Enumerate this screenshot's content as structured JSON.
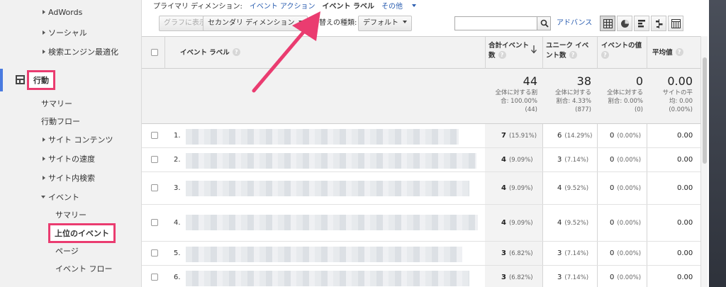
{
  "sidebar": {
    "adwords": "AdWords",
    "social": "ソーシャル",
    "seo": "検索エンジン最適化",
    "behavior": "行動",
    "summary": "サマリー",
    "flow": "行動フロー",
    "site_content": "サイト コンテンツ",
    "site_speed": "サイトの速度",
    "site_search": "サイト内検索",
    "events": "イベント",
    "events_summary": "サマリー",
    "top_events": "上位のイベント",
    "pages": "ページ",
    "event_flow": "イベント フロー"
  },
  "dimbar": {
    "primary_label": "プライマリ ディメンション:",
    "event_action": "イベント アクション",
    "event_label": "イベント ラベル",
    "other": "その他"
  },
  "toolbar": {
    "graph_btn": "グラフに表示",
    "secondary_dim": "セカンダリ ディメンション",
    "sort_label": "替えの種類:",
    "sort_value": "デフォルト",
    "advanced": "アドバンス"
  },
  "table": {
    "headers": {
      "label": "イベント ラベル",
      "total_events_1": "合計イベント",
      "total_events_2": "数",
      "unique_events_1": "ユニーク イベ",
      "unique_events_2": "ント数",
      "event_value": "イベントの値",
      "avg_value": "平均値"
    },
    "totals": {
      "total_events": "44",
      "total_events_s1": "全体に対する割",
      "total_events_s2": "合: 100.00%",
      "total_events_s3": "(44)",
      "unique_events": "38",
      "unique_events_s1": "全体に対する",
      "unique_events_s2": "割合: 4.33%",
      "unique_events_s3": "(877)",
      "event_value": "0",
      "event_value_s1": "全体に対する",
      "event_value_s2": "割合: 0.00%",
      "event_value_s3": "(0)",
      "avg_value": "0.00",
      "avg_value_s1": "サイトの平",
      "avg_value_s2": "均: 0.00",
      "avg_value_s3": "(0.00%)"
    },
    "rows": [
      {
        "num": "1.",
        "total": "7",
        "total_pct": "(15.91%)",
        "unique": "6",
        "unique_pct": "(14.29%)",
        "value": "0",
        "value_pct": "(0.00%)",
        "avg": "0.00"
      },
      {
        "num": "2.",
        "total": "4",
        "total_pct": "(9.09%)",
        "unique": "3",
        "unique_pct": "(7.14%)",
        "value": "0",
        "value_pct": "(0.00%)",
        "avg": "0.00"
      },
      {
        "num": "3.",
        "total": "4",
        "total_pct": "(9.09%)",
        "unique": "4",
        "unique_pct": "(9.52%)",
        "value": "0",
        "value_pct": "(0.00%)",
        "avg": "0.00"
      },
      {
        "num": "4.",
        "total": "4",
        "total_pct": "(9.09%)",
        "unique": "4",
        "unique_pct": "(9.52%)",
        "value": "0",
        "value_pct": "(0.00%)",
        "avg": "0.00"
      },
      {
        "num": "5.",
        "total": "3",
        "total_pct": "(6.82%)",
        "unique": "3",
        "unique_pct": "(7.14%)",
        "value": "0",
        "value_pct": "(0.00%)",
        "avg": "0.00"
      },
      {
        "num": "6.",
        "total": "3",
        "total_pct": "(6.82%)",
        "unique": "3",
        "unique_pct": "(7.14%)",
        "value": "0",
        "value_pct": "(0.00%)",
        "avg": "0.00"
      }
    ]
  },
  "colors": {
    "highlight": "#ea3c70",
    "link": "#2a5db0",
    "active": "#4a7be0"
  }
}
